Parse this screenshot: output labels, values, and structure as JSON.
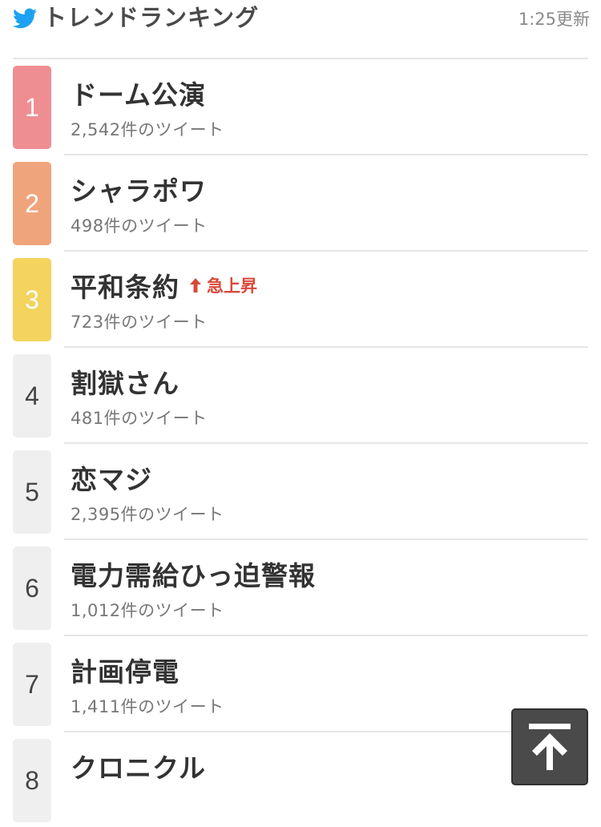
{
  "header": {
    "title": "トレンドランキング",
    "updated": "1:25更新",
    "icon": "twitter-bird-icon",
    "icon_color": "#1da1f2"
  },
  "trends": [
    {
      "rank": "1",
      "title": "ドーム公演",
      "count": "2,542件のツイート",
      "color": "#ef8e92",
      "rising": null
    },
    {
      "rank": "2",
      "title": "シャラポワ",
      "count": "498件のツイート",
      "color": "#f0a47c",
      "rising": null
    },
    {
      "rank": "3",
      "title": "平和条約",
      "count": "723件のツイート",
      "color": "#f4d35e",
      "rising": "急上昇"
    },
    {
      "rank": "4",
      "title": "割獄さん",
      "count": "481件のツイート",
      "color": null,
      "rising": null
    },
    {
      "rank": "5",
      "title": "恋マジ",
      "count": "2,395件のツイート",
      "color": null,
      "rising": null
    },
    {
      "rank": "6",
      "title": "電力需給ひっ迫警報",
      "count": "1,012件のツイート",
      "color": null,
      "rising": null
    },
    {
      "rank": "7",
      "title": "計画停電",
      "count": "1,411件のツイート",
      "color": null,
      "rising": null
    },
    {
      "rank": "8",
      "title": "クロニクル",
      "count": "",
      "color": null,
      "rising": null
    }
  ],
  "rising_color": "#d84a3a",
  "scroll_top": {
    "icon": "arrow-up-to-top-icon"
  }
}
